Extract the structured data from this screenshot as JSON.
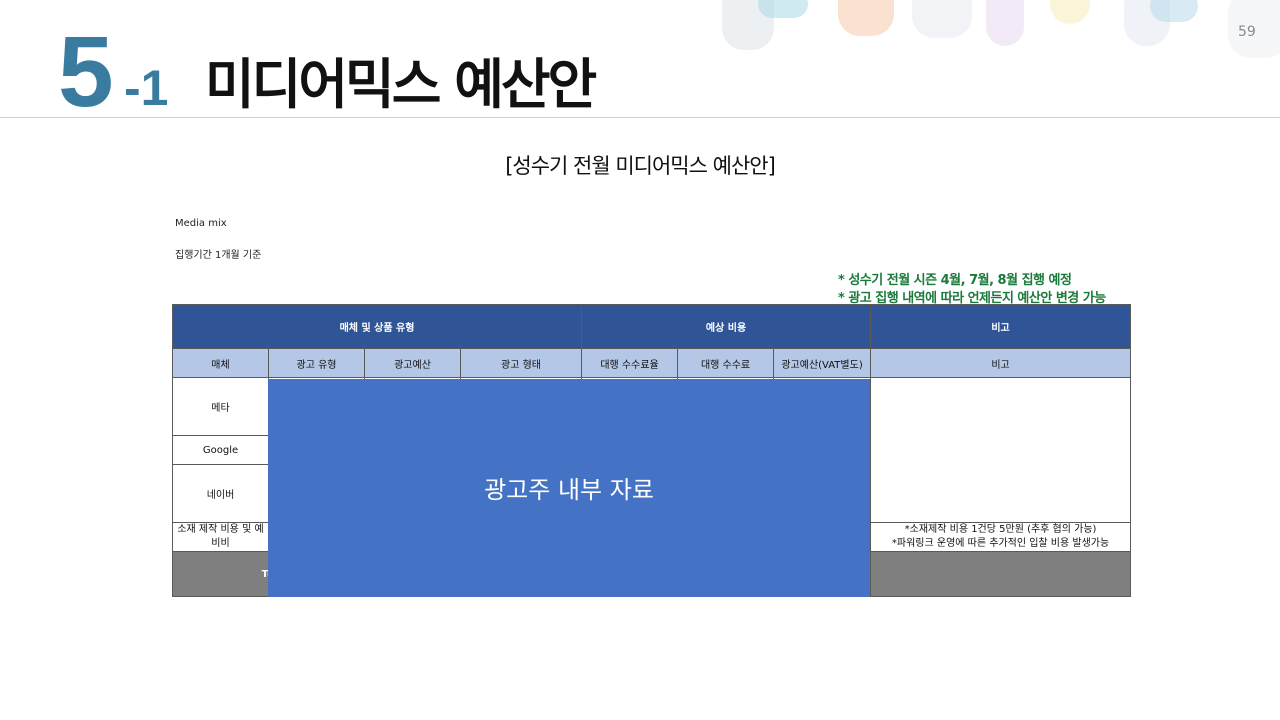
{
  "page_number": "59",
  "header": {
    "number": "5",
    "sub_number": "-1",
    "title": "미디어믹스 예산안"
  },
  "subtitle": "[성수기 전월 미디어믹스 예산안]",
  "notes": {
    "media_mix": "Media mix",
    "period": "집행기간 1개월 기준"
  },
  "green_notes": [
    "* 성수기 전월 시즌 4월, 7월, 8월 집행 예정",
    "* 광고 집행 내역에 따라 언제든지 예산안 변경 가능"
  ],
  "table": {
    "group_headers": [
      "매체 및 상품 유형",
      "예상 비용",
      "비고"
    ],
    "columns": [
      "매체",
      "광고 유형",
      "광고예산",
      "광고 형태",
      "대행 수수료율",
      "대행 수수료",
      "광고예산(VAT별도)",
      "비고"
    ],
    "rows": [
      "메타",
      "Google",
      "네이버",
      "소재 제작 비용 및 예비비"
    ],
    "remarks": [
      "*소재제작 비용 1건당 5만원 (추후 협의 가능)",
      "*파워링크 운영에 따른 추가적인 입찰 비용 발생가능"
    ],
    "total_label": "To"
  },
  "overlay_text": "광고주 내부 자료",
  "colors": {
    "header_dark": "#2f5597",
    "header_light": "#b4c7e7",
    "overlay": "#4472c4",
    "total": "#7f7f7f",
    "accent": "#3a7ca0",
    "green": "#1a7a3a"
  }
}
